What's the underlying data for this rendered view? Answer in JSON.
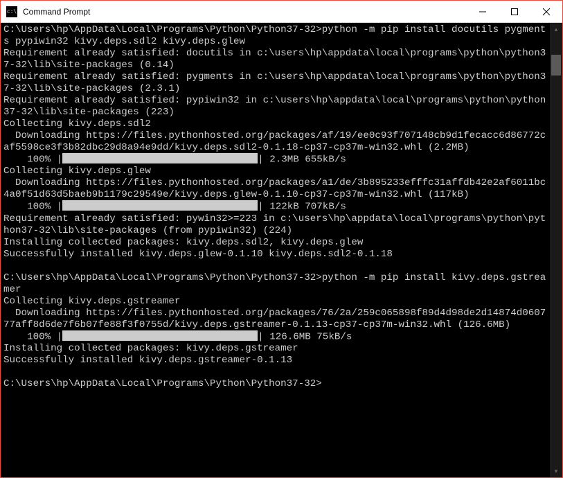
{
  "window": {
    "title": "Command Prompt"
  },
  "terminal": {
    "lines": [
      {
        "t": "prompt",
        "prompt": "C:\\Users\\hp\\AppData\\Local\\Programs\\Python\\Python37-32>",
        "cmd": "python -m pip install docutils pygments pypiwin32 kivy.deps.sdl2 kivy.deps.glew"
      },
      {
        "t": "text",
        "v": "Requirement already satisfied: docutils in c:\\users\\hp\\appdata\\local\\programs\\python\\python37-32\\lib\\site-packages (0.14)"
      },
      {
        "t": "text",
        "v": "Requirement already satisfied: pygments in c:\\users\\hp\\appdata\\local\\programs\\python\\python37-32\\lib\\site-packages (2.3.1)"
      },
      {
        "t": "text",
        "v": "Requirement already satisfied: pypiwin32 in c:\\users\\hp\\appdata\\local\\programs\\python\\python37-32\\lib\\site-packages (223)"
      },
      {
        "t": "text",
        "v": "Collecting kivy.deps.sdl2"
      },
      {
        "t": "text",
        "v": "  Downloading https://files.pythonhosted.org/packages/af/19/ee0c93f707148cb9d1fecacc6d86772caf5598ce3f3b82dbc29d8a94e9dd/kivy.deps.sdl2-0.1.18-cp37-cp37m-win32.whl (2.2MB)"
      },
      {
        "t": "progress",
        "pct": "100%",
        "size": "2.3MB",
        "speed": "655kB/s"
      },
      {
        "t": "text",
        "v": "Collecting kivy.deps.glew"
      },
      {
        "t": "text",
        "v": "  Downloading https://files.pythonhosted.org/packages/a1/de/3b895233efffc31affdb42e2af6011bc4a0f51d63d5baeb9b1179c29549e/kivy.deps.glew-0.1.10-cp37-cp37m-win32.whl (117kB)"
      },
      {
        "t": "progress",
        "pct": "100%",
        "size": "122kB",
        "speed": "707kB/s"
      },
      {
        "t": "text",
        "v": "Requirement already satisfied: pywin32>=223 in c:\\users\\hp\\appdata\\local\\programs\\python\\python37-32\\lib\\site-packages (from pypiwin32) (224)"
      },
      {
        "t": "text",
        "v": "Installing collected packages: kivy.deps.sdl2, kivy.deps.glew"
      },
      {
        "t": "text",
        "v": "Successfully installed kivy.deps.glew-0.1.10 kivy.deps.sdl2-0.1.18"
      },
      {
        "t": "blank"
      },
      {
        "t": "prompt",
        "prompt": "C:\\Users\\hp\\AppData\\Local\\Programs\\Python\\Python37-32>",
        "cmd": "python -m pip install kivy.deps.gstreamer"
      },
      {
        "t": "text",
        "v": "Collecting kivy.deps.gstreamer"
      },
      {
        "t": "text",
        "v": "  Downloading https://files.pythonhosted.org/packages/76/2a/259c065898f89d4d98de2d14874d060777aff8d6de7f6b07fe88f3f0755d/kivy.deps.gstreamer-0.1.13-cp37-cp37m-win32.whl (126.6MB)"
      },
      {
        "t": "progress",
        "pct": "100%",
        "size": "126.6MB",
        "speed": "75kB/s"
      },
      {
        "t": "text",
        "v": "Installing collected packages: kivy.deps.gstreamer"
      },
      {
        "t": "text",
        "v": "Successfully installed kivy.deps.gstreamer-0.1.13"
      },
      {
        "t": "blank"
      },
      {
        "t": "prompt",
        "prompt": "C:\\Users\\hp\\AppData\\Local\\Programs\\Python\\Python37-32>",
        "cmd": ""
      }
    ]
  }
}
